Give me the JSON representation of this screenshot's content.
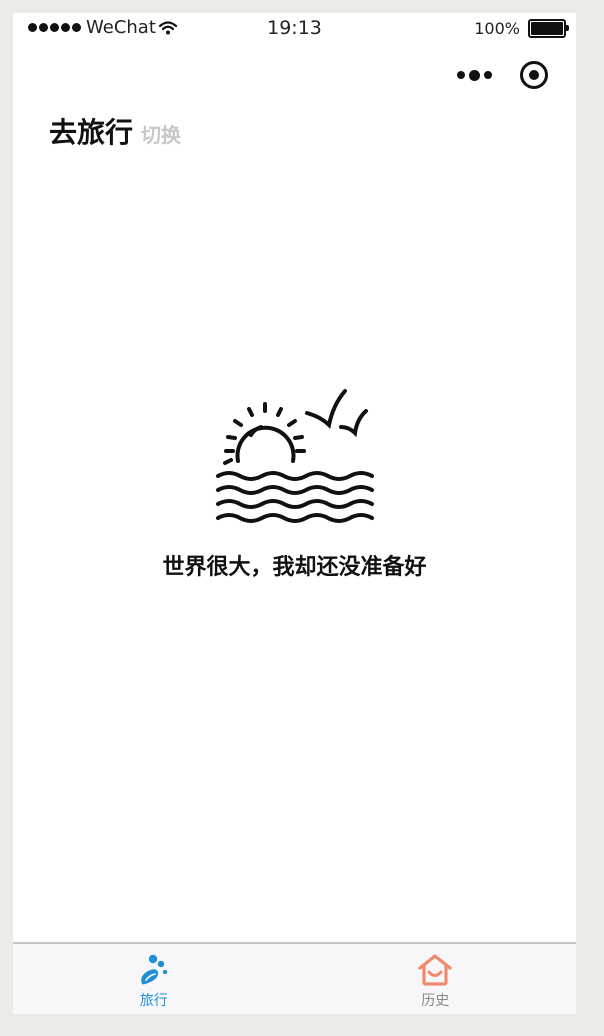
{
  "status_bar": {
    "carrier": "WeChat",
    "time": "19:13",
    "battery": "100%",
    "battery_level": 1.0
  },
  "header": {
    "title": "去旅行",
    "switch_label": "切换"
  },
  "main": {
    "illustration_icon": "sunset-sea-birds-icon",
    "message": "世界很大，我却还没准备好"
  },
  "tabbar": {
    "tabs": [
      {
        "label": "旅行",
        "icon": "travel-icon",
        "active": true,
        "color": "#1f8fd8"
      },
      {
        "label": "历史",
        "icon": "home-smile-icon",
        "active": false,
        "color": "#f08a6c"
      }
    ]
  }
}
